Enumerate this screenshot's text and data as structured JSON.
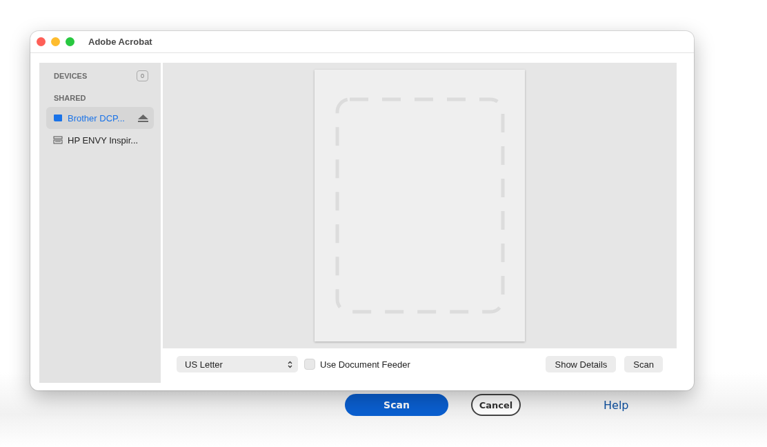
{
  "window": {
    "title": "Adobe Acrobat"
  },
  "sidebar": {
    "sections": [
      {
        "label": "DEVICES",
        "count": "0"
      },
      {
        "label": "SHARED",
        "items": [
          {
            "label": "Brother DCP...",
            "selected": true,
            "kind": "scanner-blue",
            "eject": true
          },
          {
            "label": "HP ENVY Inspir...",
            "selected": false,
            "kind": "scanner",
            "eject": false
          }
        ]
      }
    ]
  },
  "toolbar": {
    "paper_size": "US Letter",
    "document_feeder": {
      "label": "Use Document Feeder",
      "checked": false
    },
    "buttons": [
      "Show Details",
      "Scan"
    ]
  },
  "background_dialog": {
    "buttons": [
      {
        "label": "Scan",
        "kind": "primary"
      },
      {
        "label": "Cancel",
        "kind": "secondary"
      },
      {
        "label": "Help",
        "kind": "link"
      }
    ]
  }
}
